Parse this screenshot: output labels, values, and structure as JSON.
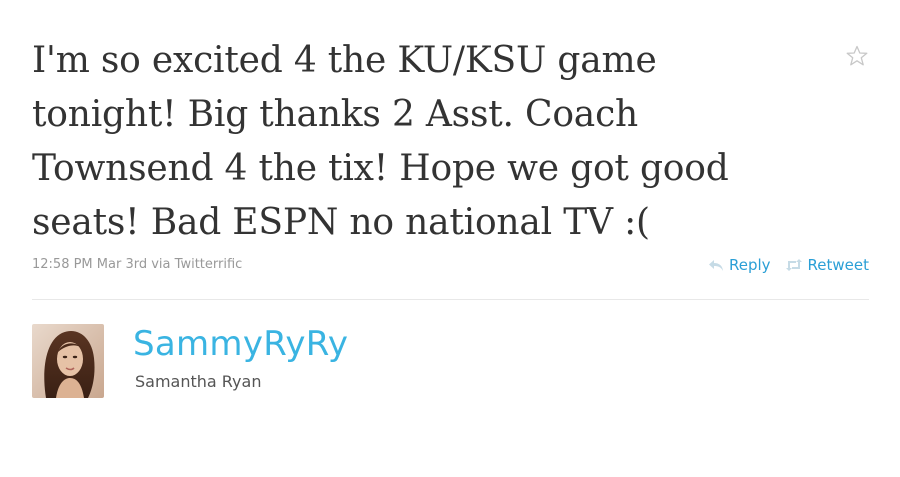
{
  "tweet": {
    "text_lines": [
      "I'm so excited 4 the KU/KSU game",
      "tonight! Big thanks 2 Asst. Coach",
      "Townsend 4 the tix! Hope we got good",
      "seats! Bad ESPN no national TV :("
    ],
    "timestamp": "12:58 PM Mar 3rd",
    "via_label": "via",
    "client": "Twitterrific"
  },
  "actions": {
    "reply_label": "Reply",
    "retweet_label": "Retweet"
  },
  "author": {
    "screen_name": "SammyRyRy",
    "full_name": "Samantha Ryan"
  },
  "icons": {
    "favorite": "star-icon",
    "reply": "reply-arrow-icon",
    "retweet": "retweet-icon"
  },
  "colors": {
    "tweet_text": "#333333",
    "link_blue": "#2a9fd6",
    "screen_name_blue": "#3ab4e2",
    "meta_gray": "#999999"
  }
}
